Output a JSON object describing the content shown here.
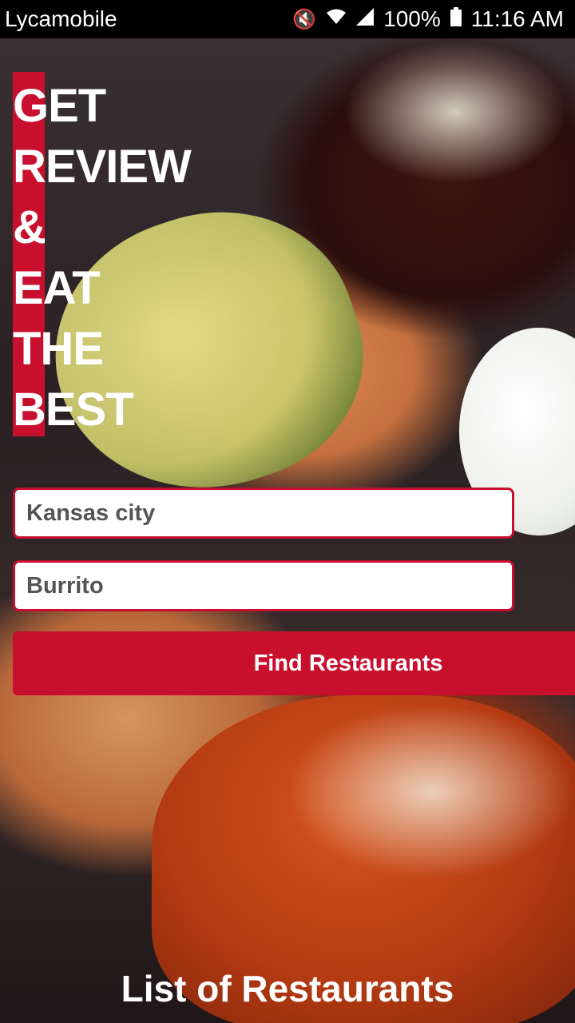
{
  "status_bar": {
    "carrier": "Lycamobile",
    "battery": "100%",
    "time": "11:16 AM",
    "icons": [
      "mute-icon",
      "wifi-icon",
      "signal-icon",
      "battery-icon"
    ]
  },
  "hero": {
    "headline_lines": [
      "GET",
      "REVIEW",
      "&",
      "EAT",
      "THE",
      "BEST"
    ]
  },
  "search": {
    "location_value": "Kansas city",
    "food_value": "Burrito",
    "find_button_label": "Find Restaurants"
  },
  "footer": {
    "list_link_label": "List of Restaurants"
  },
  "colors": {
    "accent": "#c8102e"
  }
}
